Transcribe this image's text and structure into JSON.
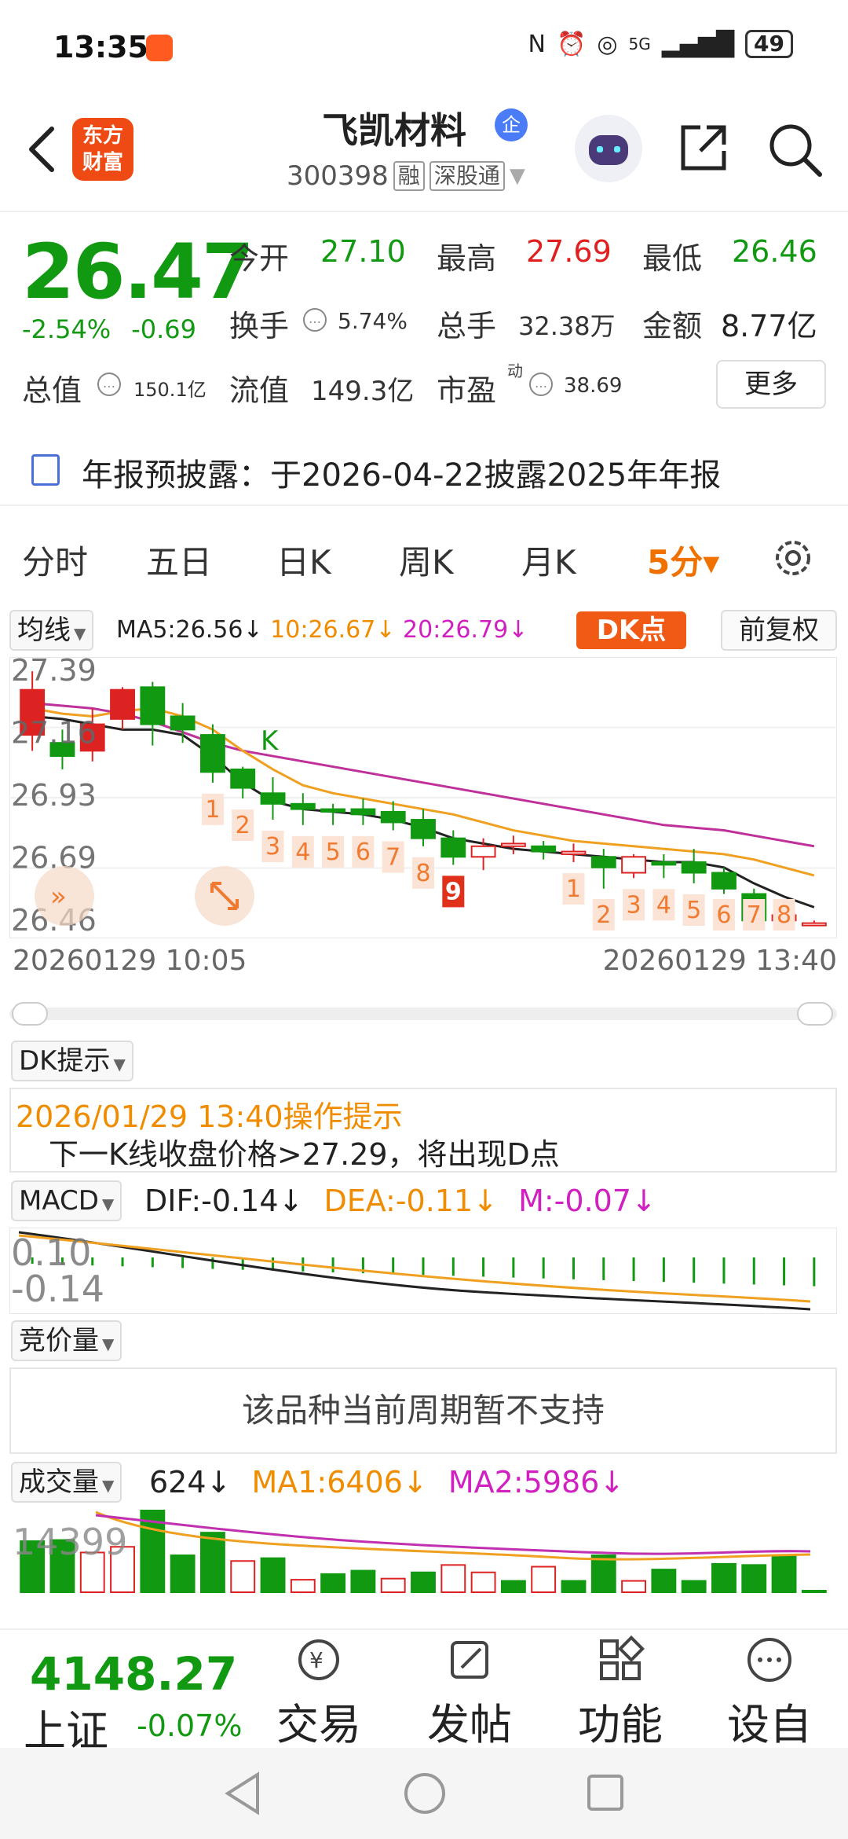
{
  "status": {
    "time": "13:35",
    "battery": "49",
    "network": "5G"
  },
  "header": {
    "stock_name": "飞凯材料",
    "qi_badge": "企",
    "code": "300398",
    "tag_rong": "融",
    "tag_sgt": "深股通",
    "logo_line1": "东方",
    "logo_line2": "财富"
  },
  "quote": {
    "price": "26.47",
    "change_pct": "-2.54%",
    "change_abs": "-0.69",
    "open_label": "今开",
    "open": "27.10",
    "high_label": "最高",
    "high": "27.69",
    "low_label": "最低",
    "low": "26.46",
    "turnover_label": "换手",
    "turnover": "5.74%",
    "volume_label": "总手",
    "volume": "32.38万",
    "amount_label": "金额",
    "amount": "8.77亿",
    "mcap_label": "总值",
    "mcap": "150.1亿",
    "float_label": "流值",
    "float": "149.3亿",
    "pe_label": "市盈",
    "pe_sup": "动",
    "pe": "38.69",
    "more": "更多"
  },
  "announce": "年报预披露：于2026-04-22披露2025年年报",
  "tabs": [
    "分时",
    "五日",
    "日K",
    "周K",
    "月K"
  ],
  "active_tab": "5分▾",
  "ma": {
    "dropdown": "均线",
    "ma5": "MA5:26.56↓",
    "ma10": "10:26.67↓",
    "ma20": "20:26.79↓",
    "dk": "DK点",
    "fq": "前复权"
  },
  "kline": {
    "y_labels": [
      "27.39",
      "27.16",
      "26.93",
      "26.69",
      "26.46"
    ],
    "date_left": "20260129 10:05",
    "date_right": "20260129 13:40",
    "k_marker": "K",
    "colors": {
      "up": "#dd2222",
      "down": "#119911",
      "ma5": "#222222",
      "ma10": "#f0a020",
      "ma20": "#c0309a",
      "seq": "#f07a30"
    }
  },
  "chart_data": {
    "type": "candlestick",
    "y_range": [
      26.46,
      27.45
    ],
    "candles": [
      {
        "o": 27.18,
        "c": 27.35,
        "h": 27.42,
        "l": 27.12
      },
      {
        "o": 27.15,
        "c": 27.1,
        "h": 27.2,
        "l": 27.05
      },
      {
        "o": 27.12,
        "c": 27.22,
        "h": 27.28,
        "l": 27.08
      },
      {
        "o": 27.24,
        "c": 27.35,
        "h": 27.36,
        "l": 27.2
      },
      {
        "o": 27.36,
        "c": 27.22,
        "h": 27.38,
        "l": 27.14
      },
      {
        "o": 27.25,
        "c": 27.2,
        "h": 27.3,
        "l": 27.15
      },
      {
        "o": 27.18,
        "c": 27.04,
        "h": 27.22,
        "l": 27.0
      },
      {
        "o": 27.05,
        "c": 26.98,
        "h": 27.06,
        "l": 26.94
      },
      {
        "o": 26.96,
        "c": 26.92,
        "h": 27.02,
        "l": 26.86
      },
      {
        "o": 26.92,
        "c": 26.9,
        "h": 26.96,
        "l": 26.84
      },
      {
        "o": 26.9,
        "c": 26.89,
        "h": 26.92,
        "l": 26.84
      },
      {
        "o": 26.9,
        "c": 26.88,
        "h": 26.94,
        "l": 26.84
      },
      {
        "o": 26.89,
        "c": 26.85,
        "h": 26.93,
        "l": 26.82
      },
      {
        "o": 26.86,
        "c": 26.79,
        "h": 26.9,
        "l": 26.76
      },
      {
        "o": 26.79,
        "c": 26.72,
        "h": 26.82,
        "l": 26.69
      },
      {
        "o": 26.72,
        "c": 26.76,
        "h": 26.79,
        "l": 26.67
      },
      {
        "o": 26.76,
        "c": 26.77,
        "h": 26.8,
        "l": 26.73
      },
      {
        "o": 26.76,
        "c": 26.74,
        "h": 26.78,
        "l": 26.71
      },
      {
        "o": 26.73,
        "c": 26.74,
        "h": 26.77,
        "l": 26.7
      },
      {
        "o": 26.72,
        "c": 26.68,
        "h": 26.75,
        "l": 26.6
      },
      {
        "o": 26.66,
        "c": 26.72,
        "h": 26.73,
        "l": 26.64
      },
      {
        "o": 26.7,
        "c": 26.69,
        "h": 26.73,
        "l": 26.64
      },
      {
        "o": 26.7,
        "c": 26.66,
        "h": 26.75,
        "l": 26.62
      },
      {
        "o": 26.66,
        "c": 26.6,
        "h": 26.68,
        "l": 26.58
      },
      {
        "o": 26.58,
        "c": 26.48,
        "h": 26.6,
        "l": 26.46
      },
      {
        "o": 26.48,
        "c": 26.5,
        "h": 26.51,
        "l": 26.45
      },
      {
        "o": 26.47,
        "c": 26.47,
        "h": 26.48,
        "l": 26.46
      }
    ],
    "ma5": [
      27.25,
      27.24,
      27.22,
      27.2,
      27.2,
      27.18,
      27.1,
      27.0,
      26.93,
      26.9,
      26.89,
      26.88,
      26.86,
      26.83,
      26.79,
      26.77,
      26.75,
      26.74,
      26.73,
      26.72,
      26.71,
      26.7,
      26.7,
      26.68,
      26.62,
      26.57,
      26.53
    ],
    "ma10": [
      27.28,
      27.26,
      27.25,
      27.27,
      27.28,
      27.25,
      27.2,
      27.12,
      27.05,
      26.99,
      26.96,
      26.94,
      26.92,
      26.9,
      26.88,
      26.85,
      26.82,
      26.8,
      26.78,
      26.77,
      26.76,
      26.75,
      26.74,
      26.73,
      26.71,
      26.68,
      26.65
    ],
    "ma20": [
      27.3,
      27.29,
      27.28,
      27.26,
      27.23,
      27.19,
      27.15,
      27.12,
      27.1,
      27.08,
      27.06,
      27.04,
      27.02,
      27.0,
      26.98,
      26.96,
      26.94,
      26.92,
      26.9,
      26.88,
      26.86,
      26.84,
      26.83,
      26.82,
      26.8,
      26.78,
      26.76
    ],
    "sequence_labels": [
      {
        "i": 6,
        "t": "1"
      },
      {
        "i": 7,
        "t": "2"
      },
      {
        "i": 8,
        "t": "3"
      },
      {
        "i": 9,
        "t": "4"
      },
      {
        "i": 10,
        "t": "5"
      },
      {
        "i": 11,
        "t": "6"
      },
      {
        "i": 12,
        "t": "7"
      },
      {
        "i": 13,
        "t": "8"
      },
      {
        "i": 14,
        "t": "9",
        "solid": true
      },
      {
        "i": 18,
        "t": "1"
      },
      {
        "i": 19,
        "t": "2"
      },
      {
        "i": 20,
        "t": "3"
      },
      {
        "i": 21,
        "t": "4"
      },
      {
        "i": 22,
        "t": "5"
      },
      {
        "i": 23,
        "t": "6"
      },
      {
        "i": 24,
        "t": "7"
      },
      {
        "i": 25,
        "t": "8"
      }
    ],
    "macd": {
      "y_labels": [
        "0.10",
        "-0.14"
      ],
      "dif_label": "DIF:-0.14↓",
      "dea_label": "DEA:-0.11↓",
      "m_label": "M:-0.07↓"
    },
    "volume": {
      "value_label": "624↓",
      "ma1_label": "MA1:6406↓",
      "ma2_label": "MA2:5986↓",
      "top_label": "14399",
      "bars": [
        9000,
        9200,
        7000,
        8000,
        14399,
        6500,
        10500,
        5500,
        6000,
        2200,
        3200,
        3800,
        2400,
        3500,
        4800,
        3500,
        2000,
        4500,
        2000,
        6500,
        2000,
        4000,
        2000,
        5000,
        4800,
        6500,
        200
      ],
      "up": [
        false,
        false,
        true,
        true,
        false,
        false,
        false,
        true,
        false,
        true,
        false,
        false,
        true,
        false,
        true,
        true,
        false,
        true,
        false,
        false,
        true,
        false,
        false,
        false,
        false,
        false,
        false
      ]
    }
  },
  "dk_hint": {
    "dropdown": "DK提示",
    "title": "2026/01/29 13:40操作提示",
    "body": "下一K线收盘价格>27.29，将出现D点"
  },
  "macd_dropdown": "MACD",
  "bid": {
    "dropdown": "竞价量",
    "text": "该品种当前周期暂不支持"
  },
  "vol_dropdown": "成交量",
  "bottom": {
    "index_value": "4148.27",
    "index_name": "上证",
    "index_change": "-0.07%",
    "nav": [
      "交易",
      "发帖",
      "功能",
      "设自选"
    ]
  }
}
